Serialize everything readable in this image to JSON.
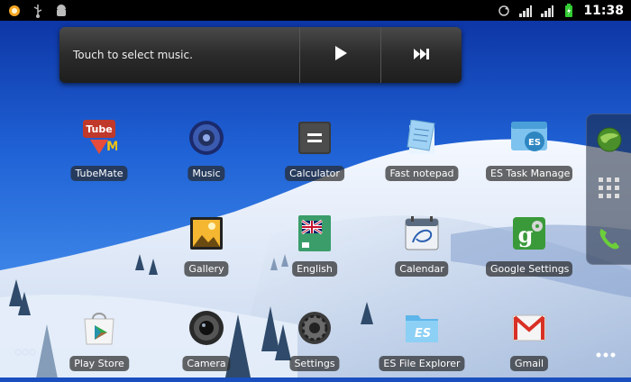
{
  "status_bar": {
    "time": "11:38",
    "left_icons": [
      "notification-dot-icon",
      "usb-icon",
      "android-debug-icon"
    ],
    "right_icons": [
      "sync-icon",
      "signal-icon",
      "signal-icon",
      "battery-charging-icon"
    ]
  },
  "music_widget": {
    "prompt": "Touch to select music.",
    "play_icon": "play-icon",
    "next_icon": "next-track-icon"
  },
  "apps": [
    {
      "label": "TubeMate"
    },
    {
      "label": "Music"
    },
    {
      "label": "Calculator"
    },
    {
      "label": "Fast notepad"
    },
    {
      "label": "ES Task Manage"
    },
    {
      "label": "Gallery"
    },
    {
      "label": "English"
    },
    {
      "label": "Calendar"
    },
    {
      "label": "Google Settings"
    },
    {
      "label": "Play Store"
    },
    {
      "label": "Camera"
    },
    {
      "label": "Settings"
    },
    {
      "label": "ES File Explorer"
    },
    {
      "label": "Gmail"
    }
  ],
  "dock": {
    "items": [
      "browser-globe-icon",
      "app-drawer-icon",
      "phone-icon"
    ]
  },
  "colors": {
    "status_bar_bg": "#000000",
    "widget_bg": "#2b2b2b",
    "label_bg": "#282828"
  }
}
